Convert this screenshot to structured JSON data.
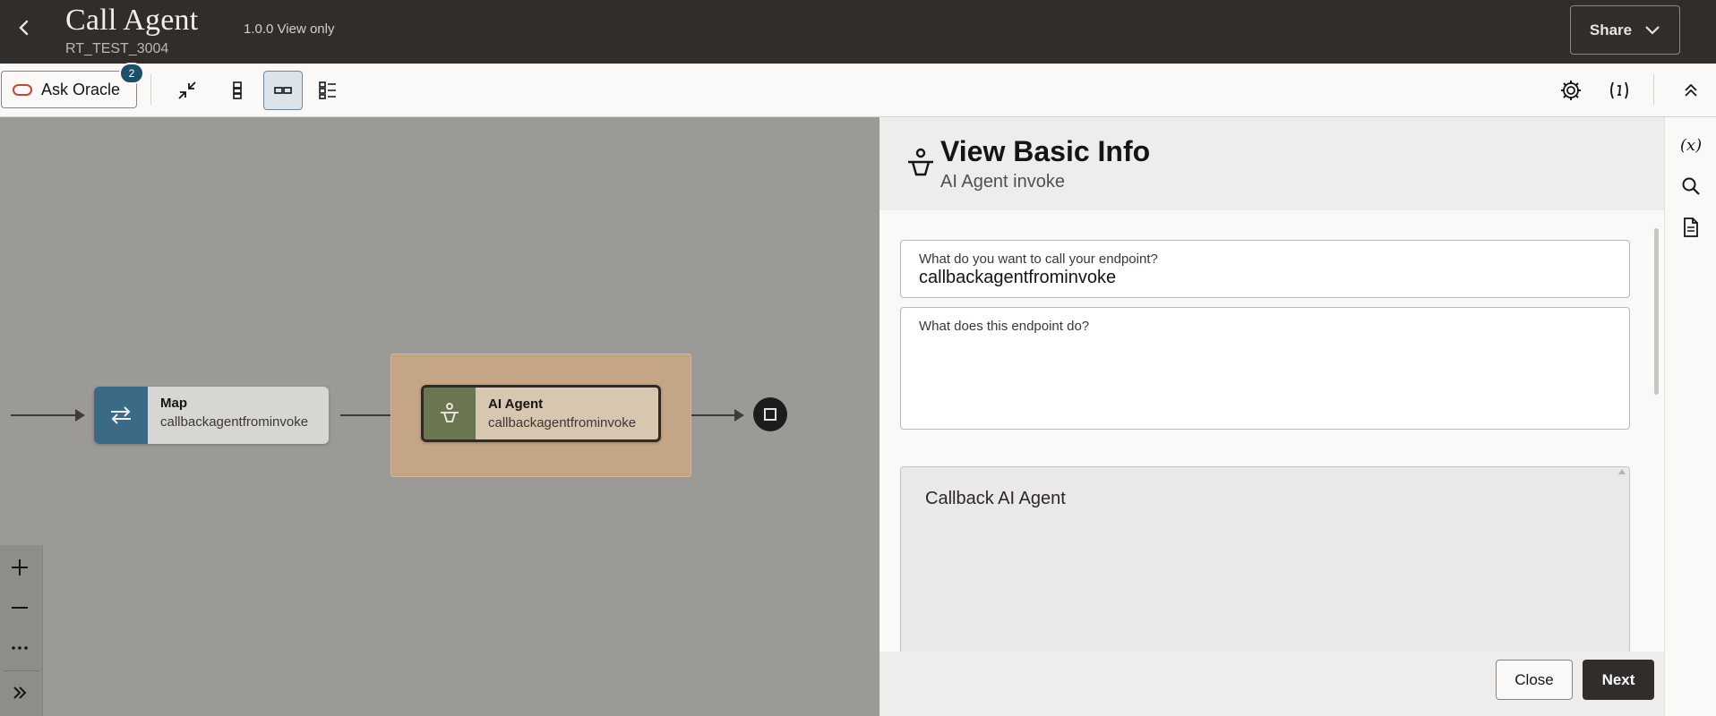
{
  "header": {
    "title": "Call Agent",
    "subtitle": "RT_TEST_3004",
    "version": "1.0.0 View only",
    "share_label": "Share"
  },
  "toolbar": {
    "ask_oracle_label": "Ask Oracle",
    "ask_oracle_badge": "2",
    "tools": [
      "collapse-icon",
      "vertical-layout-icon",
      "horizontal-layout-icon",
      "list-layout-icon"
    ],
    "right_icons": [
      "gear-icon",
      "variable-icon",
      "collapse-up-icon"
    ]
  },
  "canvas": {
    "nodes": [
      {
        "title": "Map",
        "subtitle": "callbackagentfrominvoke",
        "icon": "swap-arrows-icon",
        "color": "#3a6a86"
      },
      {
        "title": "AI Agent",
        "subtitle": "callbackagentfrominvoke",
        "icon": "ai-agent-icon",
        "color": "#6b7650",
        "selected": true
      }
    ],
    "zoom_controls": [
      "plus-icon",
      "minus-icon",
      "more-icon",
      "expand-icon"
    ]
  },
  "drawer": {
    "title": "View Basic Info",
    "subtitle": "AI Agent invoke",
    "fields": {
      "name_label": "What do you want to call your endpoint?",
      "name_value": "callbackagentfrominvoke",
      "description_label": "What does this endpoint do?",
      "description_value": ""
    },
    "readonly_text": "Callback AI Agent",
    "close_label": "Close",
    "next_label": "Next"
  },
  "right_rail": {
    "variable_label": "(x)",
    "icons": [
      "variable-x-icon",
      "search-icon",
      "document-icon"
    ]
  },
  "colors": {
    "header_bg": "#312d2a",
    "accent_blue": "#1d4f6b",
    "selection": "#c4a687"
  }
}
